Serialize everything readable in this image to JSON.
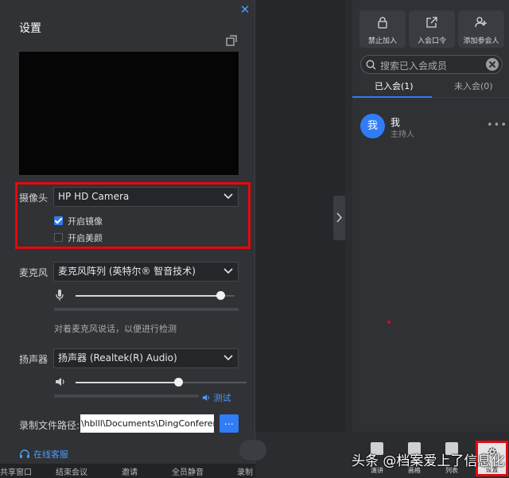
{
  "settings": {
    "title": "设置",
    "camera": {
      "label": "摄像头",
      "selected": "HP HD Camera",
      "mirror_label": "开启镜像",
      "mirror_checked": true,
      "beauty_label": "开启美颜",
      "beauty_checked": false
    },
    "microphone": {
      "label": "麦克风",
      "selected": "麦克风阵列 (英特尔® 智音技术)",
      "volume": 0.91,
      "hint": "对着麦克风说话，以便进行检测"
    },
    "speaker": {
      "label": "扬声器",
      "selected": "扬声器 (Realtek(R) Audio)",
      "volume": 0.6,
      "test_label": "测试"
    },
    "record_path": {
      "label": "录制文件路径:",
      "value": "\\hblll\\Documents\\DingConference",
      "browse_label": "..."
    },
    "support_label": "在线客服"
  },
  "participants": {
    "actions": [
      {
        "label": "禁止加入",
        "icon": "lock-icon"
      },
      {
        "label": "入会口令",
        "icon": "share-icon"
      },
      {
        "label": "添加参会人",
        "icon": "add-user-icon"
      }
    ],
    "search_placeholder": "搜索已入会成员",
    "tabs": [
      {
        "label": "已入会(1)",
        "active": true
      },
      {
        "label": "未入会(0)",
        "active": false
      }
    ],
    "members": [
      {
        "avatar": "我",
        "name": "我",
        "role": "主持人"
      }
    ]
  },
  "toolbar": {
    "buttons": [
      {
        "label": "演讲"
      },
      {
        "label": "画格"
      },
      {
        "label": "列表"
      },
      {
        "label": "设置"
      }
    ],
    "bottom_strip": [
      "共享窗口",
      "结束会议",
      "邀请",
      "全员静音",
      "录制"
    ]
  },
  "watermark": "头条 @档案爱上了信息化",
  "colors": {
    "accent": "#2f7cf6",
    "highlight": "#e8080e",
    "panel": "#303236"
  }
}
